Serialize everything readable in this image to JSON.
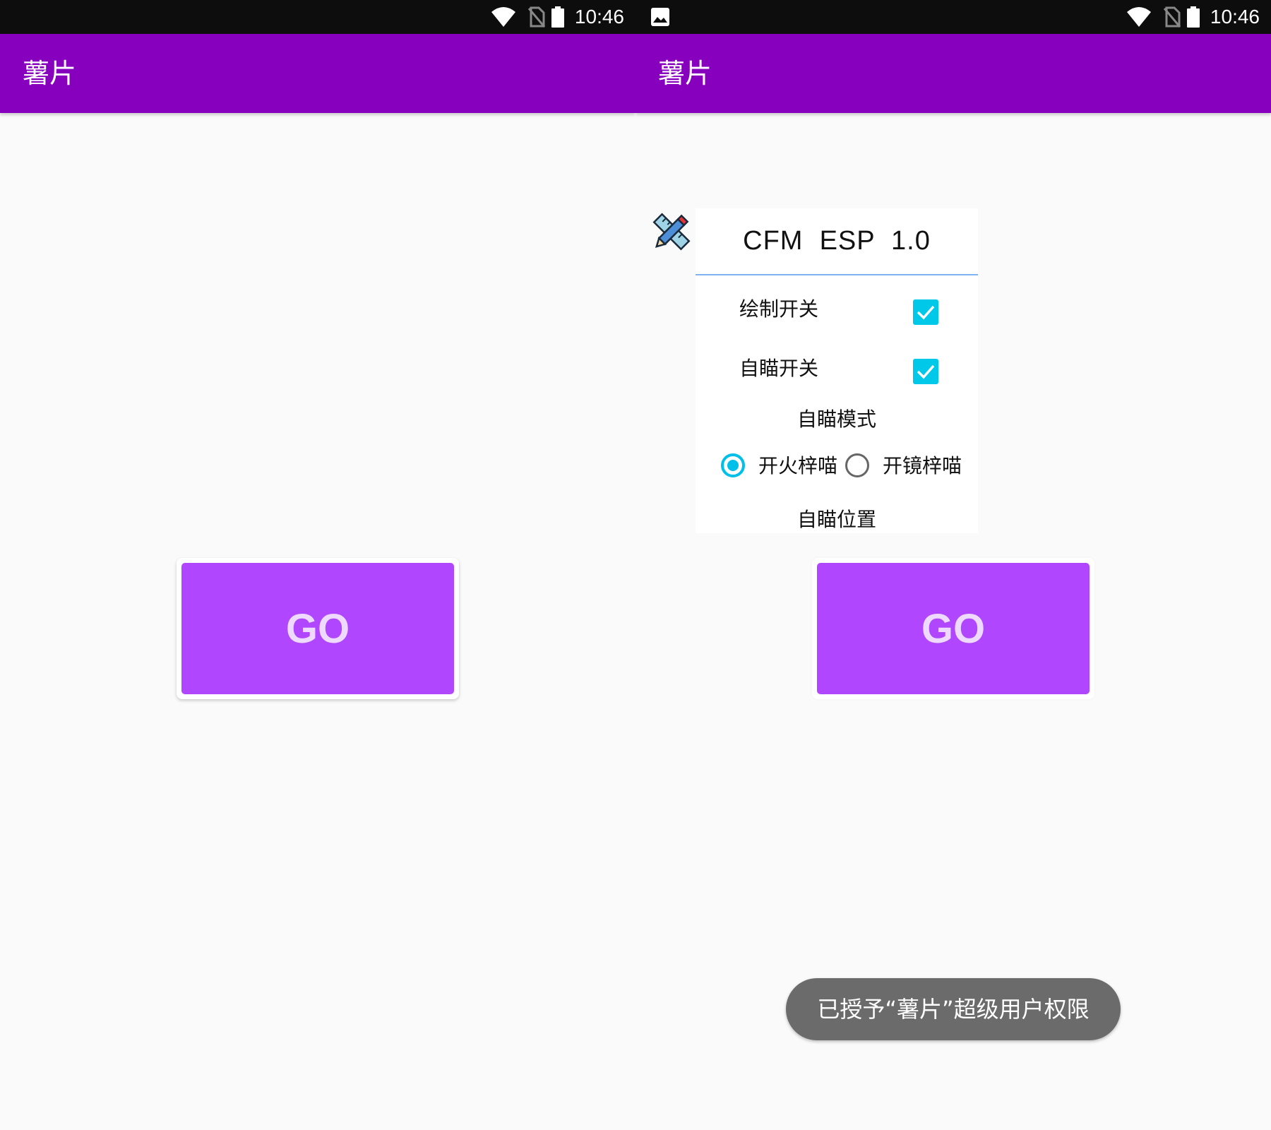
{
  "status_bar": {
    "time": "10:46",
    "icons": [
      "wifi-icon",
      "no-sim-icon",
      "battery-icon"
    ],
    "notification_icon": "gallery-icon"
  },
  "app_bar": {
    "title": "薯片",
    "color": "#8600bd"
  },
  "main": {
    "go_label": "GO",
    "button_color": "#b047ff"
  },
  "panel": {
    "title": "CFM  ESP  1.0",
    "toggles": [
      {
        "label": "绘制开关",
        "checked": true
      },
      {
        "label": "自瞄开关",
        "checked": true
      }
    ],
    "mode_label": "自瞄模式",
    "mode_options": [
      {
        "label": "开火梓喵",
        "selected": true
      },
      {
        "label": "开镜梓喵",
        "selected": false
      }
    ],
    "position_label": "自瞄位置",
    "accent_color": "#00c8e8"
  },
  "toast": {
    "text": "已授予“薯片”超级用户权限"
  }
}
